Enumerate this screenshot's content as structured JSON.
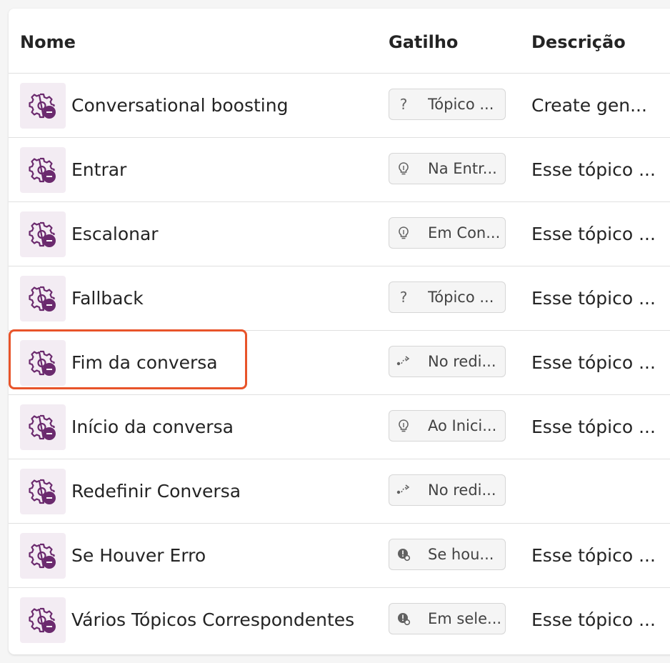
{
  "columns": {
    "name": "Nome",
    "trigger": "Gatilho",
    "description": "Descrição"
  },
  "accent_color": "#6b2a6e",
  "highlight_color": "#e8542a",
  "rows": [
    {
      "name": "Conversational boosting",
      "trigger": "Tópico ...",
      "trigger_icon": "question-icon",
      "description": "Create gen..."
    },
    {
      "name": "Entrar",
      "trigger": "Na Entr...",
      "trigger_icon": "lightbulb-icon",
      "description": "Esse tópico ..."
    },
    {
      "name": "Escalonar",
      "trigger": "Em Con...",
      "trigger_icon": "lightbulb-icon",
      "description": "Esse tópico ..."
    },
    {
      "name": "Fallback",
      "trigger": "Tópico ...",
      "trigger_icon": "question-icon",
      "description": "Esse tópico ..."
    },
    {
      "name": "Fim da conversa",
      "trigger": "No redi...",
      "trigger_icon": "redirect-icon",
      "description": "Esse tópico ..."
    },
    {
      "name": "Início da conversa",
      "trigger": "Ao Inici...",
      "trigger_icon": "lightbulb-icon",
      "description": "Esse tópico ..."
    },
    {
      "name": "Redefinir Conversa",
      "trigger": "No redi...",
      "trigger_icon": "redirect-icon",
      "description": ""
    },
    {
      "name": "Se Houver Erro",
      "trigger": "Se hou...",
      "trigger_icon": "error-gear-icon",
      "description": "Esse tópico ..."
    },
    {
      "name": "Vários Tópicos Correspondentes",
      "trigger": "Em sele...",
      "trigger_icon": "error-gear-icon",
      "description": "Esse tópico ..."
    }
  ]
}
